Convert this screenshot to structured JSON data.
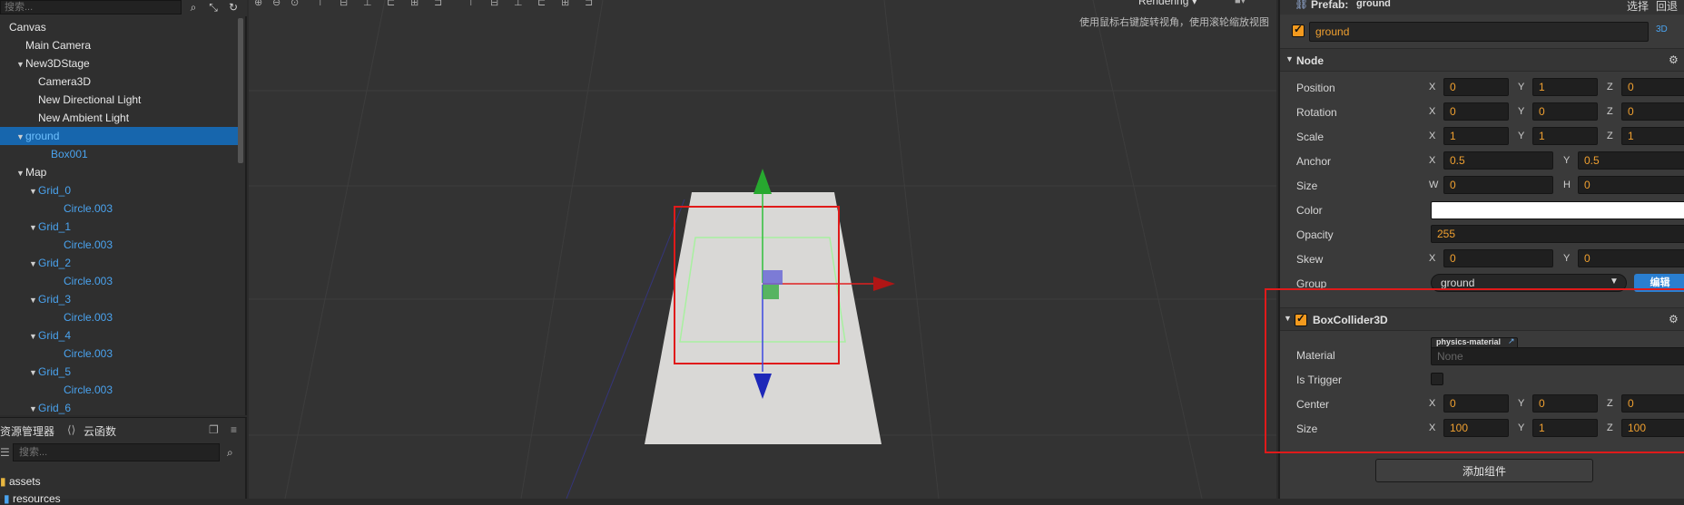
{
  "hierarchy": {
    "search_placeholder": "搜索...",
    "tree": [
      {
        "label": "Canvas",
        "depth": 0,
        "caret": "",
        "color": "white"
      },
      {
        "label": "Main Camera",
        "depth": 1,
        "caret": "",
        "color": "white"
      },
      {
        "label": "New3DStage",
        "depth": 1,
        "caret": "▼",
        "color": "white"
      },
      {
        "label": "Camera3D",
        "depth": 2,
        "caret": "",
        "color": "white"
      },
      {
        "label": "New Directional Light",
        "depth": 2,
        "caret": "",
        "color": "white"
      },
      {
        "label": "New Ambient Light",
        "depth": 2,
        "caret": "",
        "color": "white"
      },
      {
        "label": "ground",
        "depth": 1,
        "caret": "▼",
        "color": "blue",
        "selected": true
      },
      {
        "label": "Box001",
        "depth": 3,
        "caret": "",
        "color": "blue"
      },
      {
        "label": "Map",
        "depth": 1,
        "caret": "▼",
        "color": "white"
      },
      {
        "label": "Grid_0",
        "depth": 2,
        "caret": "▼",
        "color": "blue"
      },
      {
        "label": "Circle.003",
        "depth": 4,
        "caret": "",
        "color": "blue"
      },
      {
        "label": "Grid_1",
        "depth": 2,
        "caret": "▼",
        "color": "blue"
      },
      {
        "label": "Circle.003",
        "depth": 4,
        "caret": "",
        "color": "blue"
      },
      {
        "label": "Grid_2",
        "depth": 2,
        "caret": "▼",
        "color": "blue"
      },
      {
        "label": "Circle.003",
        "depth": 4,
        "caret": "",
        "color": "blue"
      },
      {
        "label": "Grid_3",
        "depth": 2,
        "caret": "▼",
        "color": "blue"
      },
      {
        "label": "Circle.003",
        "depth": 4,
        "caret": "",
        "color": "blue"
      },
      {
        "label": "Grid_4",
        "depth": 2,
        "caret": "▼",
        "color": "blue"
      },
      {
        "label": "Circle.003",
        "depth": 4,
        "caret": "",
        "color": "blue"
      },
      {
        "label": "Grid_5",
        "depth": 2,
        "caret": "▼",
        "color": "blue"
      },
      {
        "label": "Circle.003",
        "depth": 4,
        "caret": "",
        "color": "blue"
      },
      {
        "label": "Grid_6",
        "depth": 2,
        "caret": "▼",
        "color": "blue"
      }
    ]
  },
  "assets": {
    "tab_assets": "资源管理器",
    "tab_cloud": "云函数",
    "search_placeholder": "搜索...",
    "rows": [
      {
        "label": "assets"
      },
      {
        "label": "resources"
      }
    ]
  },
  "scene": {
    "hint": "使用鼠标右键旋转视角，使用滚轮缩放视图",
    "rendering_label": "Rendering"
  },
  "inspector": {
    "prefab_label": "Prefab:",
    "prefab_name": "ground",
    "select_button": "选择",
    "revert_button": "回退",
    "node_name": "ground",
    "mode_3d": "3D",
    "node_section": "Node",
    "props": {
      "position": {
        "label": "Position",
        "x": "0",
        "y": "1",
        "z": "0"
      },
      "rotation": {
        "label": "Rotation",
        "x": "0",
        "y": "0",
        "z": "0"
      },
      "scale": {
        "label": "Scale",
        "x": "1",
        "y": "1",
        "z": "1"
      },
      "anchor": {
        "label": "Anchor",
        "x": "0.5",
        "y": "0.5"
      },
      "size": {
        "label": "Size",
        "w": "0",
        "h": "0"
      },
      "color": {
        "label": "Color",
        "value": "#ffffff"
      },
      "opacity": {
        "label": "Opacity",
        "value": "255"
      },
      "skew": {
        "label": "Skew",
        "x": "0",
        "y": "0"
      },
      "group": {
        "label": "Group",
        "value": "ground",
        "edit": "编辑"
      }
    },
    "axis": {
      "x": "X",
      "y": "Y",
      "z": "Z",
      "w": "W",
      "h": "H"
    },
    "box_collider": {
      "title": "BoxCollider3D",
      "physics_tag": "physics-material",
      "material_label": "Material",
      "material_value": "None",
      "trigger_label": "Is Trigger",
      "center_label": "Center",
      "center": {
        "x": "0",
        "y": "0",
        "z": "0"
      },
      "size_label": "Size",
      "size": {
        "x": "100",
        "y": "1",
        "z": "100"
      }
    },
    "add_component": "添加组件"
  },
  "colors": {
    "accent_orange": "#f39a1e",
    "selection_blue": "#1766ad",
    "highlight_red": "#e01a1a"
  }
}
